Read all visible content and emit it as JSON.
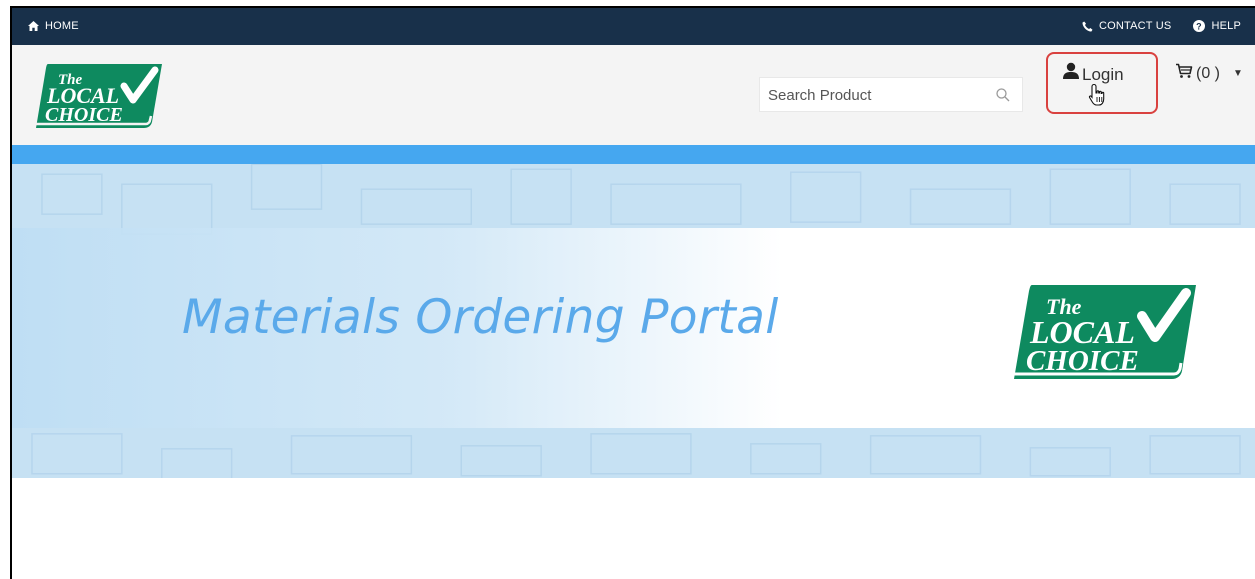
{
  "topbar": {
    "home_label": "HOME",
    "contact_label": "CONTACT US",
    "help_label": "HELP"
  },
  "header": {
    "logo_text": {
      "the": "The",
      "local": "LOCAL",
      "choice": "CHOICE"
    },
    "search": {
      "placeholder": "Search Product"
    },
    "login_label": "Login",
    "cart_label": "(0 )"
  },
  "banner": {
    "title": "Materials Ordering Portal"
  },
  "colors": {
    "topbar": "#18304a",
    "stripe": "#45a7f0",
    "banner_bg": "#c6e1f3",
    "title": "#5aa9ea",
    "logo_green": "#0e8a5f",
    "highlight": "#d9413f"
  },
  "icons": [
    "home-icon",
    "phone-icon",
    "help-icon",
    "search-icon",
    "user-icon",
    "cart-icon",
    "caret-down-icon",
    "hand-cursor-icon"
  ]
}
